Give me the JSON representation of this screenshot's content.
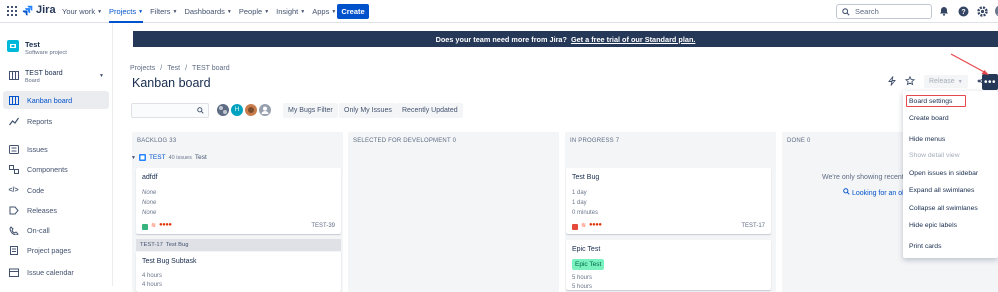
{
  "topbar": {
    "logo": "Jira",
    "nav": [
      {
        "label": "Your work",
        "active": false
      },
      {
        "label": "Projects",
        "active": true
      },
      {
        "label": "Filters",
        "active": false
      },
      {
        "label": "Dashboards",
        "active": false
      },
      {
        "label": "People",
        "active": false
      },
      {
        "label": "Insight",
        "active": false
      },
      {
        "label": "Apps",
        "active": false
      }
    ],
    "create_label": "Create",
    "search_placeholder": "Search",
    "icons": [
      "notifications-icon",
      "help-icon",
      "settings-icon",
      "profile-avatar"
    ]
  },
  "sidebar": {
    "project_name": "Test",
    "project_type": "Software project",
    "board_name": "TEST board",
    "board_sub": "Board",
    "items": [
      {
        "label": "Kanban board",
        "icon": "board-icon",
        "active": true
      },
      {
        "label": "Reports",
        "icon": "reports-icon",
        "active": false
      },
      {
        "label": "Issues",
        "icon": "issues-icon",
        "active": false
      },
      {
        "label": "Components",
        "icon": "components-icon",
        "active": false
      },
      {
        "label": "Code",
        "icon": "code-icon",
        "active": false
      },
      {
        "label": "Releases",
        "icon": "releases-icon",
        "active": false
      },
      {
        "label": "On-call",
        "icon": "on-call-icon",
        "active": false
      },
      {
        "label": "Project pages",
        "icon": "pages-icon",
        "active": false
      },
      {
        "label": "Issue calendar",
        "icon": "calendar-icon",
        "active": false
      }
    ]
  },
  "banner": {
    "text": "Does your team need more from Jira?",
    "link": "Get a free trial of our Standard plan."
  },
  "breadcrumbs": [
    "Projects",
    "/",
    "Test",
    "/",
    "TEST board"
  ],
  "page_title": "Kanban board",
  "release_label": "Release",
  "filters": {
    "avatar_letter": "H",
    "buttons": [
      "My Bugs Filter",
      "Only My Issues",
      "Recently Updated"
    ]
  },
  "columns": [
    {
      "name": "BACKLOG 33"
    },
    {
      "name": "SELECTED FOR DEVELOPMENT 0"
    },
    {
      "name": "IN PROGRESS 7"
    },
    {
      "name": "DONE 0"
    }
  ],
  "swimlane": {
    "key": "TEST",
    "count": "40 issues",
    "name": "Test"
  },
  "cards": {
    "c1": {
      "title": "adfdf",
      "lines": [
        "None",
        "None",
        "None"
      ],
      "key": "TEST-39"
    },
    "c2": {
      "title": "Test Bug",
      "lines": [
        "1 day",
        "1 day",
        "0 minutes"
      ],
      "key": "TEST-17"
    },
    "c3": {
      "title": "Epic Test",
      "epic": "Epic Test",
      "lines": [
        "5 hours",
        "5 hours"
      ]
    },
    "c4": {
      "parent_key": "TEST-17",
      "parent_title": "Test Bug",
      "title": "Test Bug Subtask",
      "lines": [
        "4 hours",
        "4 hours"
      ]
    }
  },
  "done_message": {
    "text": "We're only showing recently",
    "link": "Looking for an ol"
  },
  "menu": {
    "items": [
      {
        "label": "Board settings",
        "disabled": false
      },
      {
        "label": "Create board",
        "disabled": false
      },
      {
        "label": "Hide menus",
        "disabled": false
      },
      {
        "label": "Show detail view",
        "disabled": true
      },
      {
        "label": "Open issues in sidebar",
        "disabled": false
      },
      {
        "label": "Expand all swimlanes",
        "disabled": false
      },
      {
        "label": "Collapse all swimlanes",
        "disabled": false
      },
      {
        "label": "Hide epic labels",
        "disabled": false
      },
      {
        "label": "Print cards",
        "disabled": false
      }
    ]
  },
  "colors": {
    "primary": "#0052cc",
    "navy": "#253858",
    "highlight": "#e5484d",
    "epic_bg": "#79f2c0"
  }
}
